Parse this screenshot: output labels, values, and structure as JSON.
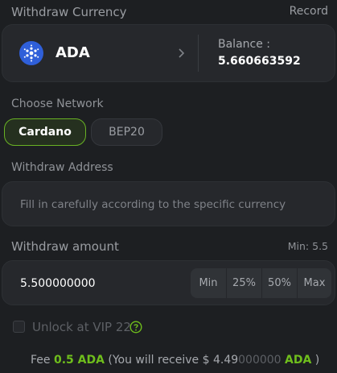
{
  "header": {
    "title": "Withdraw Currency",
    "record_label": "Record"
  },
  "currency": {
    "symbol": "ADA",
    "balance_label": "Balance :",
    "balance_value": "5.660663592",
    "icon": "cardano-icon"
  },
  "network": {
    "section_label": "Choose Network",
    "options": [
      "Cardano",
      "BEP20"
    ],
    "selected": "Cardano"
  },
  "address": {
    "section_label": "Withdraw Address",
    "placeholder": "Fill in carefully according to the specific currency"
  },
  "amount": {
    "section_label": "Withdraw amount",
    "min_label": "Min: 5.5",
    "value": "5.500000000",
    "quick_buttons": [
      "Min",
      "25%",
      "50%",
      "Max"
    ]
  },
  "vip": {
    "label": "Unlock at VIP 22",
    "icon": "help-circle-icon"
  },
  "fee": {
    "prefix": "Fee ",
    "fee_amount": "0.5 ADA",
    "middle_start": " (You will receive $ ",
    "receive_main": "4.49",
    "receive_faded": "000000",
    "receive_unit": "ADA",
    "suffix": " )"
  },
  "colors": {
    "accent_green": "#6fbe1c",
    "background": "#1d1f22",
    "card": "#26282c",
    "cardano_blue": "#2f5fd9"
  }
}
